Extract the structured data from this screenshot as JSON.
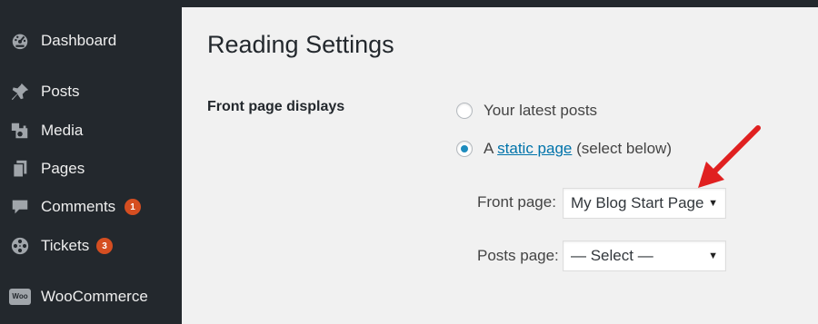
{
  "sidebar": {
    "items": [
      {
        "label": "Dashboard",
        "icon": "dashboard-icon"
      },
      {
        "label": "Posts",
        "icon": "pushpin-icon"
      },
      {
        "label": "Media",
        "icon": "media-icon"
      },
      {
        "label": "Pages",
        "icon": "pages-icon"
      },
      {
        "label": "Comments",
        "icon": "comment-icon",
        "badge": "1"
      },
      {
        "label": "Tickets",
        "icon": "film-reel-icon",
        "badge": "3"
      },
      {
        "label": "WooCommerce",
        "icon": "woocommerce-icon"
      }
    ],
    "woo_icon_text": "Woo"
  },
  "main": {
    "title": "Reading Settings",
    "front_page_displays": {
      "label": "Front page displays",
      "option_latest": "Your latest posts",
      "option_static_prefix": "A",
      "option_static_link": "static page",
      "option_static_suffix": "(select below)",
      "selected": "static"
    },
    "front_page": {
      "label": "Front page:",
      "value": "My Blog Start Page"
    },
    "posts_page": {
      "label": "Posts page:",
      "value": "— Select —"
    }
  },
  "colors": {
    "sidebar_bg": "#23282d",
    "badge": "#d54e21",
    "link": "#0073aa",
    "radio_checked": "#1e8cbe",
    "annotation_arrow": "#e02020"
  }
}
